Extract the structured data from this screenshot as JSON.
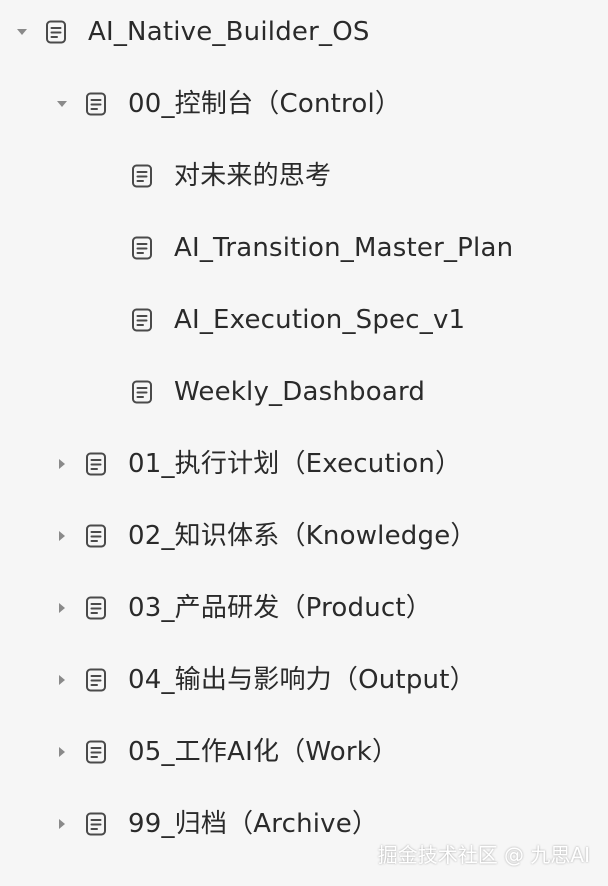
{
  "tree": {
    "root": {
      "label": "AI_Native_Builder_OS",
      "expanded": true
    },
    "control": {
      "label": "00_控制台（Control）",
      "expanded": true
    },
    "control_children": [
      {
        "label": "对未来的思考"
      },
      {
        "label": "AI_Transition_Master_Plan"
      },
      {
        "label": "AI_Execution_Spec_v1"
      },
      {
        "label": "Weekly_Dashboard"
      }
    ],
    "sections": [
      {
        "label": "01_执行计划（Execution）",
        "expanded": false
      },
      {
        "label": "02_知识体系（Knowledge）",
        "expanded": false
      },
      {
        "label": "03_产品研发（Product）",
        "expanded": false
      },
      {
        "label": "04_输出与影响力（Output）",
        "expanded": false
      },
      {
        "label": "05_工作AI化（Work）",
        "expanded": false
      },
      {
        "label": "99_归档（Archive）",
        "expanded": false
      }
    ]
  },
  "watermark": "掘金技术社区 @ 九思AI",
  "colors": {
    "background": "#f6f6f6",
    "text": "#2a2a2a",
    "icon": "#4a4a4a",
    "toggle": "#8a8a8a"
  },
  "icons": {
    "document": "document-icon",
    "expanded": "caret-down-icon",
    "collapsed": "caret-right-icon"
  }
}
